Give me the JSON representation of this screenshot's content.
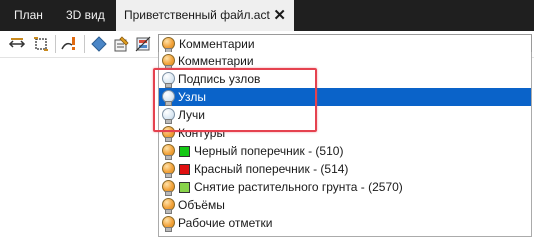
{
  "tabs": [
    {
      "label": "План",
      "active": false
    },
    {
      "label": "3D вид",
      "active": false
    },
    {
      "label": "Приветственный файл.act",
      "active": true
    }
  ],
  "tab_close_glyph": "✕",
  "toolbar": {
    "icons": [
      "move-horizontal-icon",
      "fit-view-icon",
      "triangle-warning-icon",
      "diamond-icon",
      "edit-note-icon",
      "layer-properties-icon"
    ]
  },
  "layer_combo": {
    "value": "Комментарии",
    "icon": "lightbulb-on-icon"
  },
  "layer_list": [
    {
      "label": "Комментарии",
      "icon": "lightbulb-on-icon",
      "state": "on"
    },
    {
      "label": "Подпись узлов",
      "icon": "lightbulb-off-icon",
      "state": "off"
    },
    {
      "label": "Узлы",
      "icon": "lightbulb-off-icon",
      "state": "off",
      "selected": true
    },
    {
      "label": "Лучи",
      "icon": "lightbulb-off-icon",
      "state": "off"
    },
    {
      "label": "Контуры",
      "icon": "lightbulb-on-icon",
      "state": "on"
    },
    {
      "label": "Черный поперечник - (510)",
      "icon": "lightbulb-on-icon",
      "state": "on",
      "swatch": "#14c814"
    },
    {
      "label": "Красный поперечник - (514)",
      "icon": "lightbulb-on-icon",
      "state": "on",
      "swatch": "#e01010"
    },
    {
      "label": "Снятие растительного грунта - (2570)",
      "icon": "lightbulb-on-icon",
      "state": "on",
      "swatch": "#88d44a"
    },
    {
      "label": "Объёмы",
      "icon": "lightbulb-on-icon",
      "state": "on"
    },
    {
      "label": "Рабочие отметки",
      "icon": "lightbulb-on-icon",
      "state": "on"
    }
  ],
  "colors": {
    "tabbar_bg": "#1f1f1f",
    "selection": "#0a63c9",
    "highlight": "#e5424f"
  }
}
